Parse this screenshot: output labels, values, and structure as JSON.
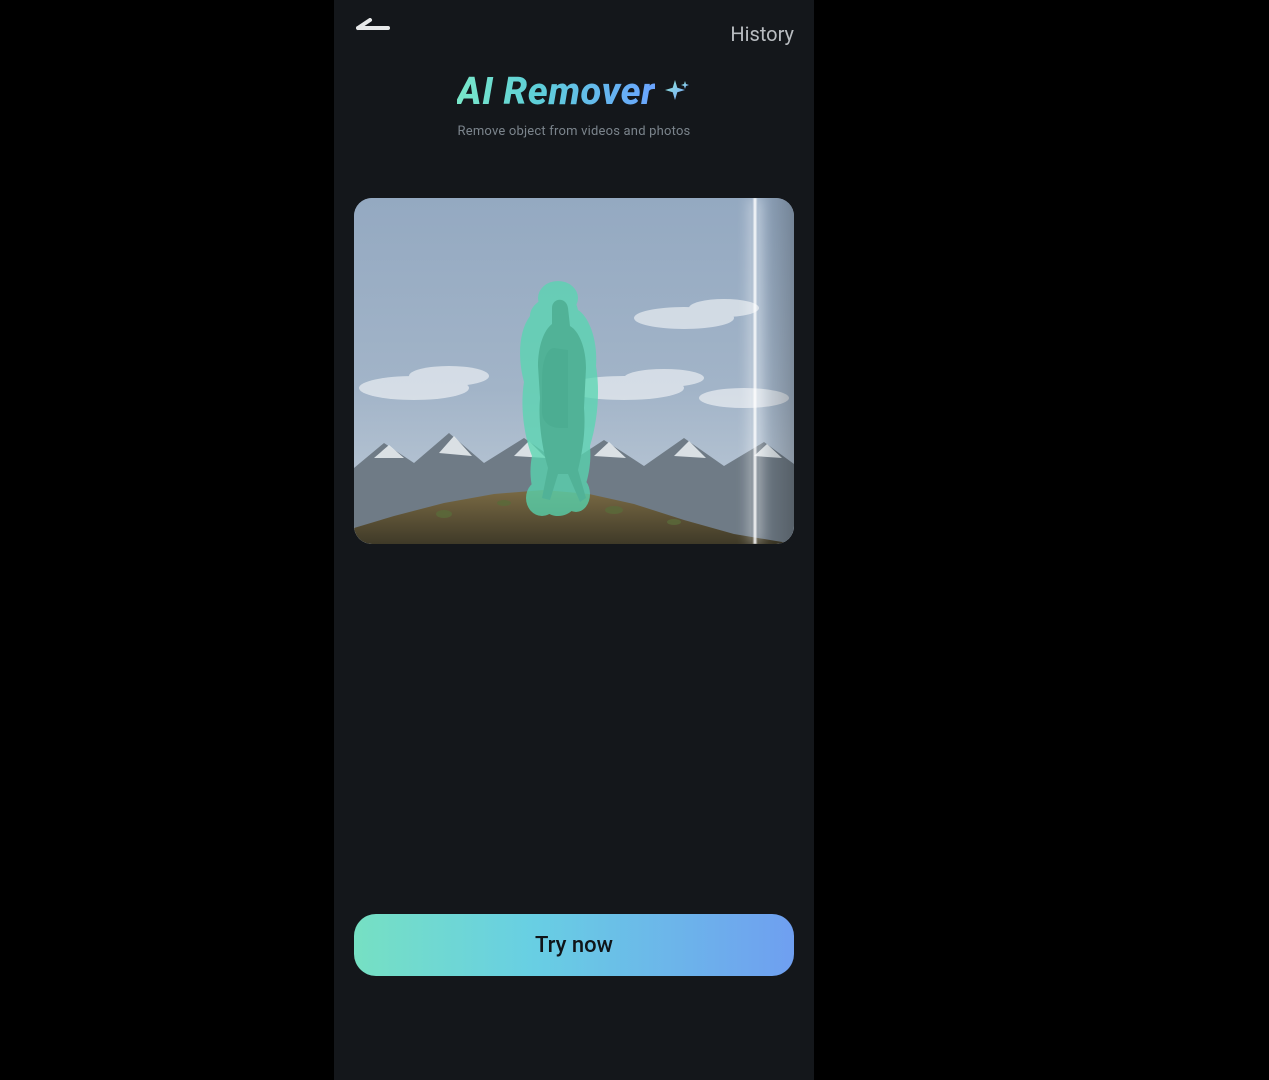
{
  "header": {
    "history_label": "History"
  },
  "title": {
    "text": "AI Remover",
    "subtitle": "Remove object from videos and photos"
  },
  "cta": {
    "label": "Try now"
  },
  "colors": {
    "accent_start": "#79e7c9",
    "accent_mid": "#5ecfd8",
    "accent_end": "#6aa4ff",
    "mask_overlay": "#57d7b1"
  },
  "preview": {
    "description": "Person with backpack standing on a rocky summit against snowy mountains and sky; a teal brush mask covers the person; a vertical AI-scan light bar sweeps near the right edge."
  }
}
